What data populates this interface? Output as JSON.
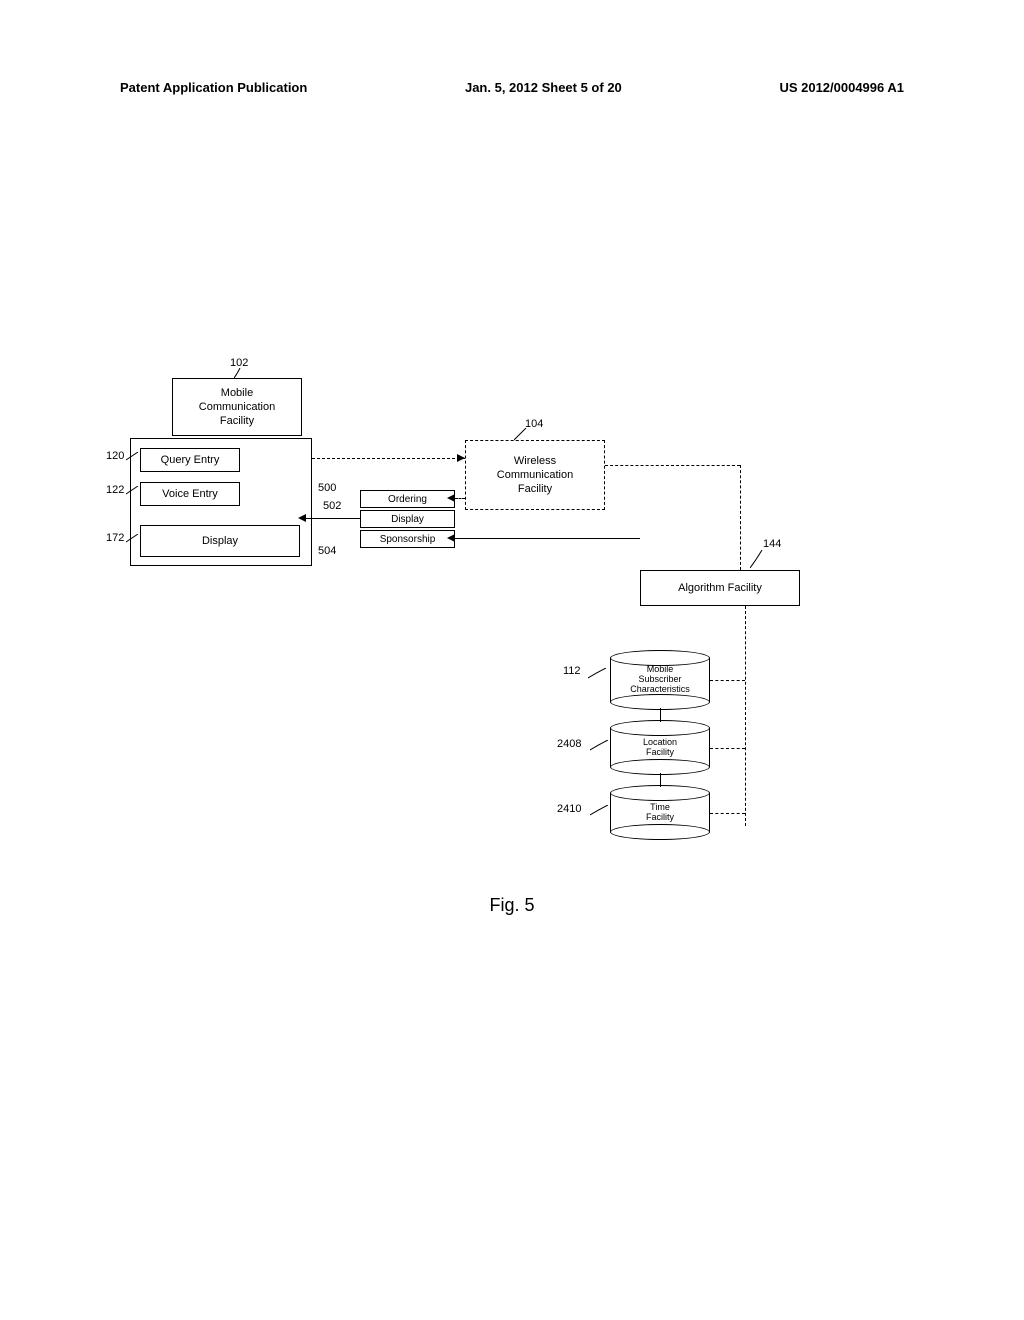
{
  "header": {
    "left": "Patent Application Publication",
    "mid": "Jan. 5, 2012  Sheet 5 of 20",
    "right": "US 2012/0004996 A1"
  },
  "refs": {
    "r102": "102",
    "r104": "104",
    "r120": "120",
    "r122": "122",
    "r172": "172",
    "r500": "500",
    "r502": "502",
    "r504": "504",
    "r144": "144",
    "r112": "112",
    "r2408": "2408",
    "r2410": "2410"
  },
  "boxes": {
    "mcf": "Mobile\nCommunication\nFacility",
    "query": "Query Entry",
    "voice": "Voice Entry",
    "display": "Display",
    "wcf": "Wireless\nCommunication\nFacility",
    "ordering": "Ordering",
    "display2": "Display",
    "sponsorship": "Sponsorship",
    "algorithm": "Algorithm Facility",
    "msc": "Mobile\nSubscriber\nCharacteristics",
    "location": "Location\nFacility",
    "time": "Time\nFacility"
  },
  "figure": "Fig. 5"
}
